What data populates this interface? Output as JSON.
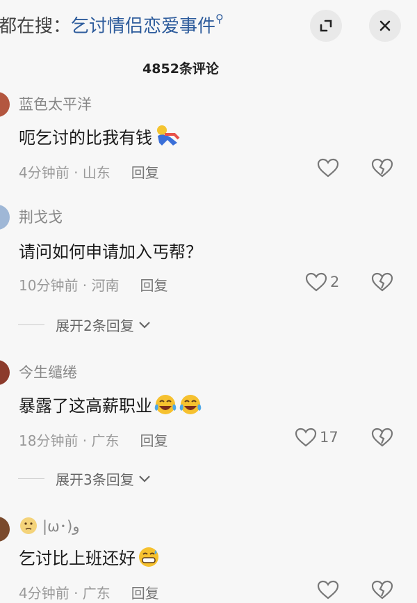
{
  "header": {
    "search_prefix": "都在搜：",
    "search_topic": "乞讨情侣恋爱事件",
    "minimize_icon": "minimize-icon",
    "close_icon": "close-icon"
  },
  "comment_count": "4852条评论",
  "comments": [
    {
      "name": "蓝色太平洋",
      "text": "呃乞讨的比我有钱",
      "emoji": "running-figure",
      "time": "4分钟前 · 山东",
      "reply": "回复",
      "likes": "",
      "avatar_color": "#b3563f"
    },
    {
      "name": "荆戈戈",
      "text": "请问如何申请加入丐帮？",
      "time": "10分钟前 · 河南",
      "reply": "回复",
      "likes": "2",
      "expand": "展开2条回复",
      "avatar_color": "#9fb7d6"
    },
    {
      "name": "今生缱绻",
      "text": "暴露了这高薪职业",
      "emoji": "crying-laughing",
      "time": "18分钟前 · 广东",
      "reply": "回复",
      "likes": "17",
      "expand": "展开3条回复",
      "avatar_color": "#8c3b2c"
    },
    {
      "name": "|ω･)و",
      "text": "乞讨比上班还好",
      "emoji": "grinning-sweat",
      "time": "4分钟前 · 广东",
      "reply": "回复",
      "likes": "",
      "avatar_color": "#7a4a2d"
    }
  ]
}
